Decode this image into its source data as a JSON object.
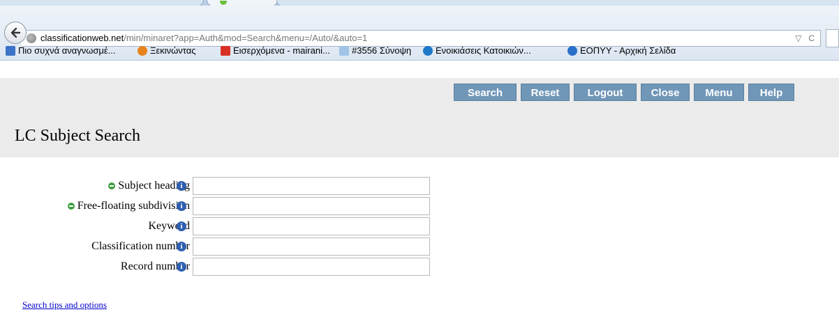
{
  "browser": {
    "url_host": "classificationweb.net",
    "url_path": "/min/minaret?app=Auth&mod=Search&menu=/Auto/&auto=1",
    "url_bar_glyphs": {
      "dropdown": "▽",
      "reload": "C"
    },
    "bookmarks": [
      {
        "label": "Πιο συχνά αναγνωσμέ...",
        "icon": "most-visited-icon",
        "color": "#3b73c8"
      },
      {
        "label": "Ξεκινώντας",
        "icon": "firefox-icon",
        "color": "#e8821c"
      },
      {
        "label": "Εισερχόμενα - mairani...",
        "icon": "gmail-icon",
        "color": "#d93025"
      },
      {
        "label": "#3556 Σύνοψη",
        "icon": "page-icon",
        "color": "#9fc3e6"
      },
      {
        "label": "Ενοικιάσεις Κατοικιών...",
        "icon": "bird-icon",
        "color": "#1f78c8"
      },
      {
        "label": "ΕΟΠΥΥ - Αρχική Σελίδα",
        "icon": "globe-icon",
        "color": "#2a6fc9"
      }
    ]
  },
  "toolbar": {
    "buttons": [
      {
        "label": "Search"
      },
      {
        "label": "Reset"
      },
      {
        "label": "Logout"
      },
      {
        "label": "Close"
      },
      {
        "label": "Menu"
      },
      {
        "label": "Help"
      }
    ],
    "color": "#7096b8"
  },
  "page": {
    "title": "LC Subject Search"
  },
  "form": {
    "fields": [
      {
        "label": "Subject heading",
        "bullet": true,
        "value": ""
      },
      {
        "label": "Free-floating subdivision",
        "bullet": true,
        "value": ""
      },
      {
        "label": "Keyword",
        "bullet": false,
        "value": ""
      },
      {
        "label": "Classification number",
        "bullet": false,
        "value": ""
      },
      {
        "label": "Record number",
        "bullet": false,
        "value": ""
      }
    ],
    "info_glyph": "i"
  },
  "links": {
    "search_tips": "Search tips and options"
  }
}
